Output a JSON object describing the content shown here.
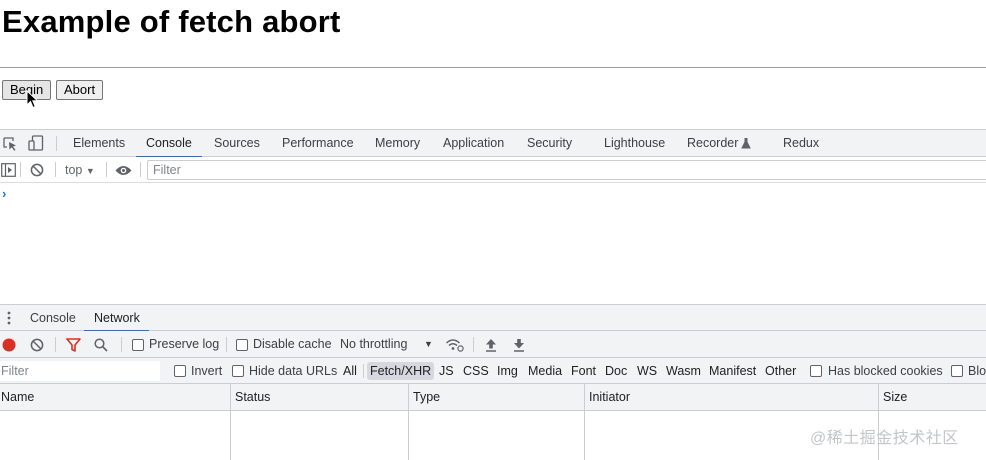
{
  "page": {
    "title": "Example of fetch abort",
    "buttons": {
      "begin": "Begin",
      "abort": "Abort"
    }
  },
  "devtools": {
    "tabs": [
      "Elements",
      "Console",
      "Sources",
      "Performance",
      "Memory",
      "Application",
      "Security",
      "Lighthouse",
      "Recorder",
      "Redux"
    ],
    "active_tab": "Console",
    "console": {
      "context": "top",
      "filter_placeholder": "Filter",
      "prompt": "›"
    },
    "drawer": {
      "tabs": [
        "Console",
        "Network"
      ],
      "active_tab": "Network"
    },
    "network": {
      "toolbar": {
        "preserve_log": "Preserve log",
        "disable_cache": "Disable cache",
        "throttling": "No throttling"
      },
      "filter": {
        "placeholder": "Filter",
        "invert": "Invert",
        "hide_data_urls": "Hide data URLs",
        "types": [
          "All",
          "Fetch/XHR",
          "JS",
          "CSS",
          "Img",
          "Media",
          "Font",
          "Doc",
          "WS",
          "Wasm",
          "Manifest",
          "Other"
        ],
        "active_type": "Fetch/XHR",
        "has_blocked_cookies": "Has blocked cookies",
        "blocked_requests": "Blo"
      },
      "columns": [
        "Name",
        "Status",
        "Type",
        "Initiator",
        "Size"
      ]
    }
  },
  "watermark": "@稀土掘金技术社区",
  "colors": {
    "accent": "#1a73e8",
    "record": "#d93025",
    "toolbar_bg": "#f1f3f4"
  }
}
